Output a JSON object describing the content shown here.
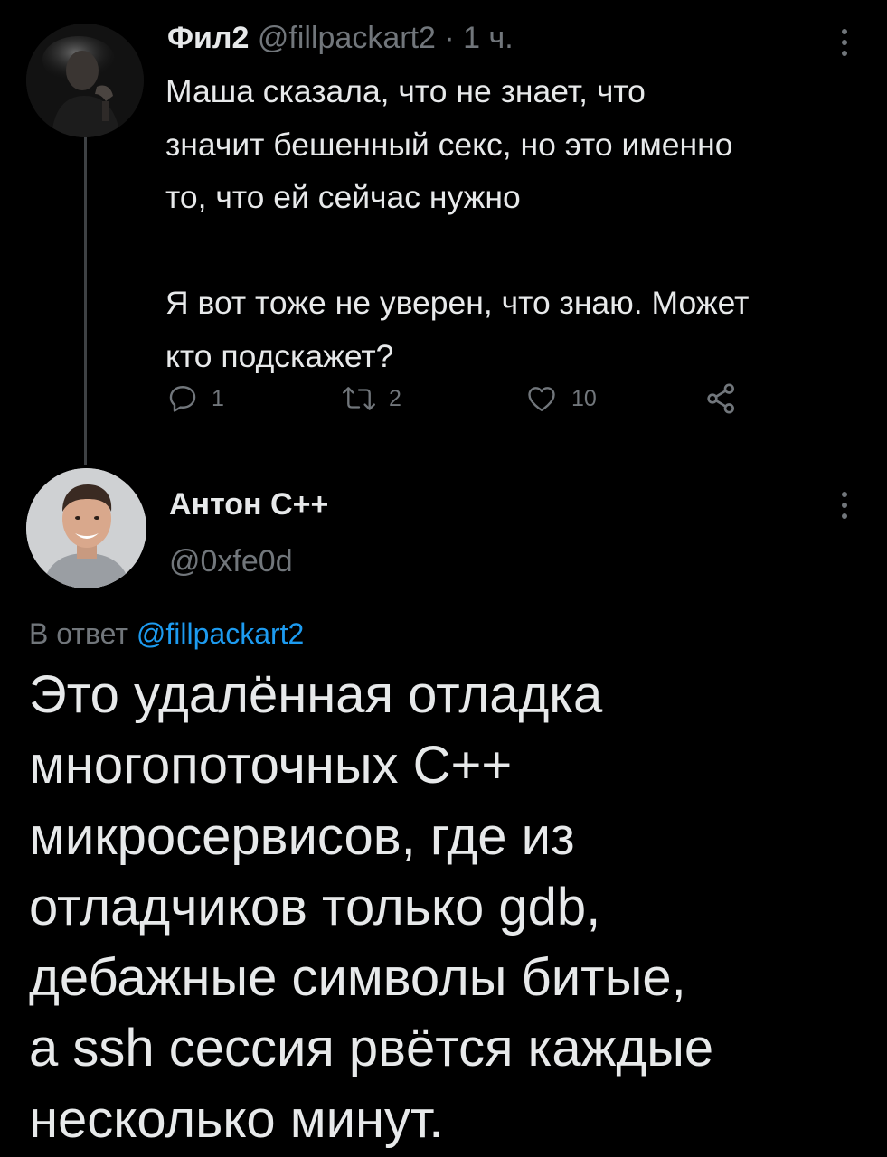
{
  "colors": {
    "background": "#000000",
    "text": "#e7e9ea",
    "secondary_text": "#71767b",
    "accent": "#1d9bf0",
    "thread_line": "#3e4144"
  },
  "tweet1": {
    "author_name": "Фил2",
    "handle": "@fillpackart2",
    "separator": "·",
    "time": "1 ч.",
    "body": "Маша сказала, что не знает, что\nзначит бешенный секс, но это именно\nто, что ей сейчас нужно\n\nЯ вот тоже не уверен, что знаю. Может\nкто подскажет?",
    "actions": {
      "reply_icon": "reply-icon",
      "reply_count": "1",
      "retweet_icon": "retweet-icon",
      "retweet_count": "2",
      "like_icon": "like-icon",
      "like_count": "10",
      "share_icon": "share-icon"
    },
    "more_icon": "more-vertical-icon"
  },
  "tweet2": {
    "author_name": "Антон С++",
    "handle": "@0xfe0d",
    "reply_prefix": "В ответ ",
    "reply_mention": "@fillpackart2",
    "body": "Это удалённая отладка\nмногопоточных С++\nмикросервисов, где из\nотладчиков только gdb,\nдебажные символы битые,\nа ssh сессия рвётся каждые\nнесколько минут.",
    "more_icon": "more-vertical-icon"
  }
}
